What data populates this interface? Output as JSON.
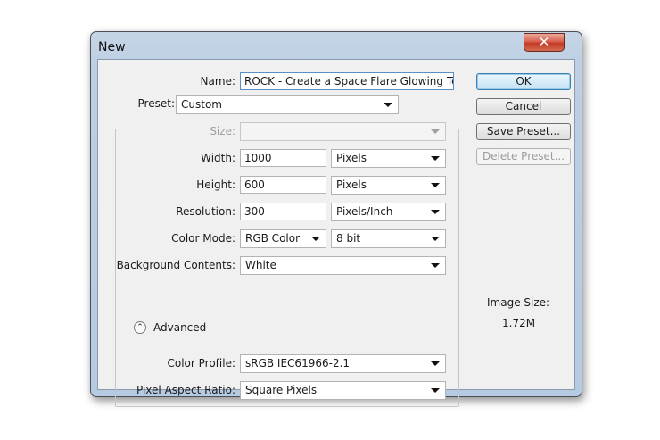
{
  "window": {
    "title": "New",
    "close_glyph": "✕"
  },
  "name": {
    "label": "Name:",
    "value": "ROCK - Create a Space Flare Glowing Text"
  },
  "preset": {
    "label": "Preset:",
    "value": "Custom"
  },
  "size": {
    "label": "Size:",
    "value": ""
  },
  "width": {
    "label": "Width:",
    "value": "1000",
    "unit": "Pixels"
  },
  "height": {
    "label": "Height:",
    "value": "600",
    "unit": "Pixels"
  },
  "resolution": {
    "label": "Resolution:",
    "value": "300",
    "unit": "Pixels/Inch"
  },
  "color_mode": {
    "label": "Color Mode:",
    "value": "RGB Color",
    "depth": "8 bit"
  },
  "background": {
    "label": "Background Contents:",
    "value": "White"
  },
  "advanced": {
    "label": "Advanced",
    "icon": "chevron-up-icon"
  },
  "color_profile": {
    "label": "Color Profile:",
    "value": "sRGB IEC61966-2.1"
  },
  "pixel_aspect": {
    "label": "Pixel Aspect Ratio:",
    "value": "Square Pixels"
  },
  "buttons": {
    "ok": "OK",
    "cancel": "Cancel",
    "save_preset": "Save Preset...",
    "delete_preset": "Delete Preset..."
  },
  "image_size": {
    "label": "Image Size:",
    "value": "1.72M"
  }
}
